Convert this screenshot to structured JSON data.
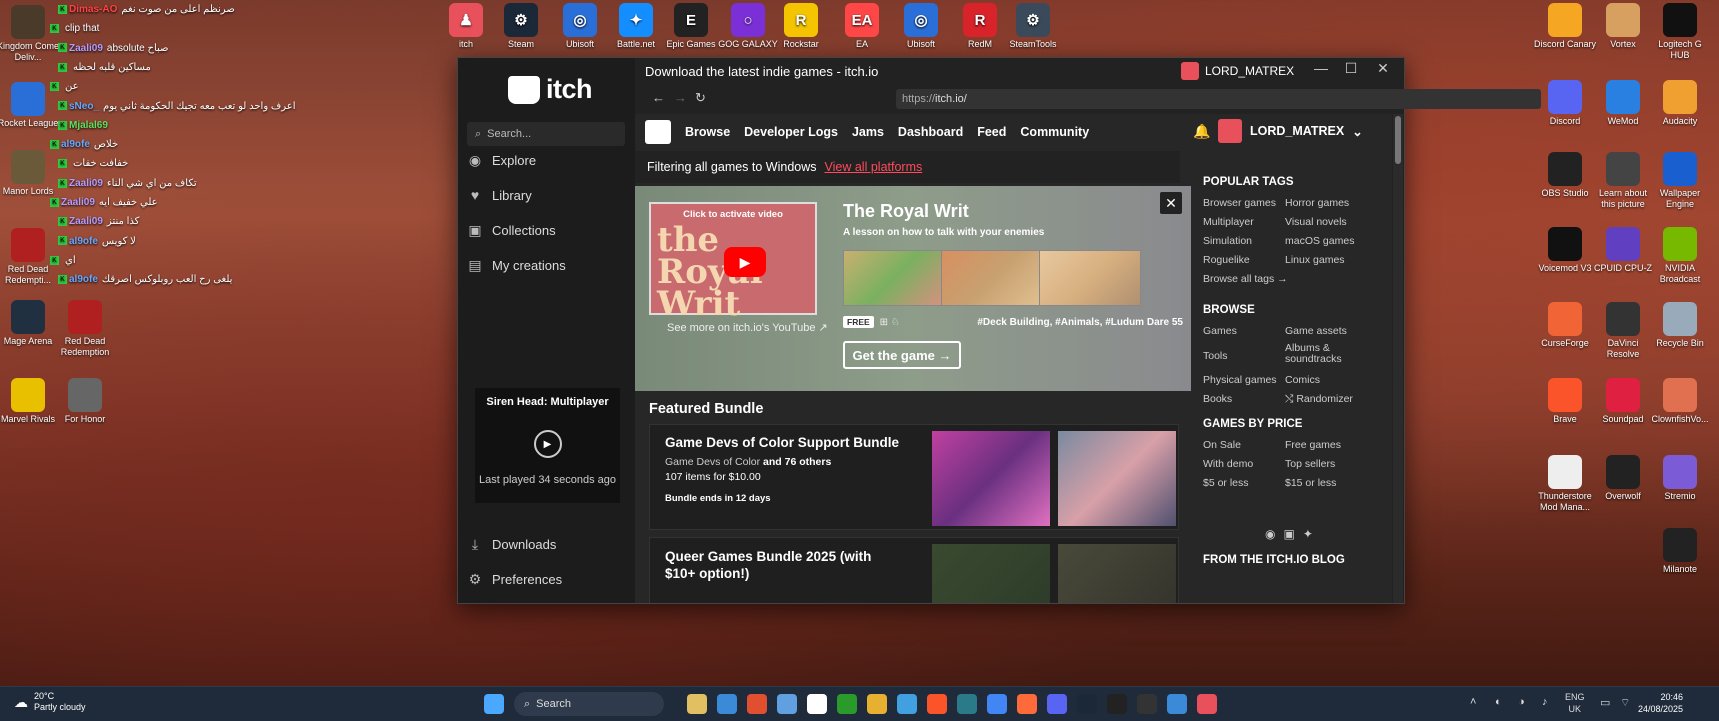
{
  "desktop_icons_top": [
    {
      "label": "itch",
      "color": "#e8505b",
      "glyph": "♟"
    },
    {
      "label": "Steam",
      "color": "#1b2838",
      "glyph": "⚙"
    },
    {
      "label": "Ubisoft",
      "color": "#2a6fd8",
      "glyph": "◎"
    },
    {
      "label": "Battle.net",
      "color": "#148eff",
      "glyph": "✦"
    },
    {
      "label": "Epic Games",
      "color": "#222222",
      "glyph": "E"
    },
    {
      "label": "GOG GALAXY",
      "color": "#7b2fd6",
      "glyph": "○"
    },
    {
      "label": "Rockstar",
      "color": "#f5c400",
      "glyph": "R"
    },
    {
      "label": "EA",
      "color": "#ff4747",
      "glyph": "EA"
    },
    {
      "label": "Ubisoft",
      "color": "#2a6fd8",
      "glyph": "◎"
    },
    {
      "label": "RedM",
      "color": "#d8232a",
      "glyph": "R"
    },
    {
      "label": "SteamTools",
      "color": "#3a4a5a",
      "glyph": "⚙"
    }
  ],
  "desktop_icons_left": [
    {
      "label": "Kingdom Come Deliv...",
      "color": "#4a3a2a"
    },
    {
      "label": "Rocket League",
      "color": "#2a6fd8"
    },
    {
      "label": "Manor Lords",
      "color": "#6a5a3a"
    },
    {
      "label": "Red Dead Redempti...",
      "color": "#b02020"
    },
    {
      "label": "Mage Arena",
      "color": "#203040"
    },
    {
      "label": "Red Dead Redemption",
      "color": "#b02020"
    },
    {
      "label": "Marvel Rivals",
      "color": "#e8c000"
    },
    {
      "label": "For Honor",
      "color": "#666666"
    }
  ],
  "desktop_icons_right_col1": [
    {
      "label": "Discord Canary",
      "color": "#f5a623"
    },
    {
      "label": "Discord",
      "color": "#5865f2"
    },
    {
      "label": "OBS Studio",
      "color": "#222222"
    },
    {
      "label": "Voicemod V3",
      "color": "#111111"
    },
    {
      "label": "CurseForge",
      "color": "#f16436"
    },
    {
      "label": "Brave",
      "color": "#fb542b"
    },
    {
      "label": "Thunderstore Mod Mana...",
      "color": "#eeeeee"
    }
  ],
  "desktop_icons_right_col2": [
    {
      "label": "Vortex",
      "color": "#d8a060"
    },
    {
      "label": "WeMod",
      "color": "#2a80e0"
    },
    {
      "label": "Learn about this picture",
      "color": "#444444"
    },
    {
      "label": "CPUID CPU-Z",
      "color": "#6040c0"
    },
    {
      "label": "DaVinci Resolve",
      "color": "#333333"
    },
    {
      "label": "Soundpad",
      "color": "#e02040"
    },
    {
      "label": "Overwolf",
      "color": "#222222"
    }
  ],
  "desktop_icons_right_col3": [
    {
      "label": "Logitech G HUB",
      "color": "#111111"
    },
    {
      "label": "Audacity",
      "color": "#f0a030"
    },
    {
      "label": "Wallpaper Engine",
      "color": "#1a5fd0"
    },
    {
      "label": "NVIDIA Broadcast",
      "color": "#76b900"
    },
    {
      "label": "Recycle Bin",
      "color": "#9ab"
    },
    {
      "label": "ClownfishVo...",
      "color": "#e07050"
    },
    {
      "label": "Stremio",
      "color": "#7b5bd6"
    },
    {
      "label": "Milanote",
      "color": "#222222"
    }
  ],
  "chat": [
    {
      "user": "Dimas-AO",
      "text": "صرنظم اعلى من صوت نغم",
      "cls": "red"
    },
    {
      "user": "",
      "text": "clip that",
      "cls": "red"
    },
    {
      "user": "Zaali09",
      "text": "absolute صباح",
      "cls": ""
    },
    {
      "user": "",
      "text": "مساكين قلبه لحظه",
      "cls": "red"
    },
    {
      "user": "",
      "text": "عن",
      "cls": "red"
    },
    {
      "user": "sNeo_",
      "text": "اعرف واحد لو تعب معه تجيك الحكومة ثاني يوم",
      "cls": "blue"
    },
    {
      "user": "Mjalal69",
      "text": "",
      "cls": "green"
    },
    {
      "user": "al9ofe",
      "text": "خلاص",
      "cls": "blue"
    },
    {
      "user": "",
      "text": "خفافت خفات",
      "cls": ""
    },
    {
      "user": "Zaali09",
      "text": "تكاف من اي شي الناء",
      "cls": ""
    },
    {
      "user": "Zaali09",
      "text": "علي خفيف ايه",
      "cls": ""
    },
    {
      "user": "Zaali09",
      "text": "كذا منتز",
      "cls": ""
    },
    {
      "user": "al9ofe",
      "text": "لا كويس",
      "cls": "blue"
    },
    {
      "user": "",
      "text": "اي",
      "cls": "red"
    },
    {
      "user": "al9ofe",
      "text": "يلغى رح العب روبلوكس اصرقك",
      "cls": "blue"
    }
  ],
  "window": {
    "title": "Download the latest indie games - itch.io",
    "user": "LORD_MATREX",
    "url_scheme": "https://",
    "url_rest": "itch.io/"
  },
  "sidebar": {
    "logo": "itch",
    "search_placeholder": "Search...",
    "items": [
      {
        "label": "Explore",
        "icon": "◉"
      },
      {
        "label": "Library",
        "icon": "♥"
      },
      {
        "label": "Collections",
        "icon": "▣"
      },
      {
        "label": "My creations",
        "icon": "▤"
      }
    ],
    "recent_title": "Siren Head: Multiplayer",
    "recent_sub": "Last played 34 seconds ago",
    "bottom": [
      {
        "label": "Downloads",
        "icon": "⤓"
      },
      {
        "label": "Preferences",
        "icon": "⚙"
      }
    ]
  },
  "itch_nav": {
    "links": [
      "Browse",
      "Developer Logs",
      "Jams",
      "Dashboard",
      "Feed",
      "Community"
    ],
    "user": "LORD_MATREX"
  },
  "filter": {
    "text": "Filtering all games to Windows",
    "link": "View all platforms"
  },
  "hero": {
    "video_caption": "Click to activate video",
    "video_title": "the Royal Writ",
    "see_more": "See more on itch.io's YouTube ↗",
    "title": "The Royal Writ",
    "subtitle": "A lesson on how to talk with your enemies",
    "free": "FREE",
    "platforms": "⊞ ♘",
    "tags": "#Deck Building, #Animals, #Ludum Dare 55",
    "cta": "Get the game →"
  },
  "featured": {
    "heading": "Featured Bundle",
    "bundles": [
      {
        "title": "Game Devs of Color Support Bundle",
        "by": "Game Devs of Color",
        "others": "and 76 others",
        "items": "107 items for $10.00",
        "ends": "Bundle ends in 12 days"
      },
      {
        "title": "Queer Games Bundle 2025 (with $10+ option!)"
      }
    ]
  },
  "right": {
    "popular_heading": "POPULAR TAGS",
    "popular_a": [
      "Browser games",
      "Multiplayer",
      "Simulation",
      "Roguelike"
    ],
    "popular_b": [
      "Horror games",
      "Visual novels",
      "macOS games",
      "Linux games"
    ],
    "browse_all": "Browse all tags →",
    "browse_heading": "BROWSE",
    "browse_a": [
      "Games",
      "Tools",
      "Physical games",
      "Books"
    ],
    "browse_b": [
      "Game assets",
      "Albums & soundtracks",
      "Comics",
      "⤭ Randomizer"
    ],
    "price_heading": "GAMES BY PRICE",
    "price_a": [
      "On Sale",
      "With demo",
      "$5 or less"
    ],
    "price_b": [
      "Free games",
      "Top sellers",
      "$15 or less"
    ],
    "blog_heading": "FROM THE ITCH.IO BLOG",
    "social": [
      "reddit-icon",
      "facebook-icon",
      "twitter-icon"
    ]
  },
  "taskbar": {
    "temp": "20°C",
    "weather": "Partly cloudy",
    "search": "Search",
    "lang1": "ENG",
    "lang2": "UK",
    "time": "20:46",
    "date": "24/08/2025"
  }
}
